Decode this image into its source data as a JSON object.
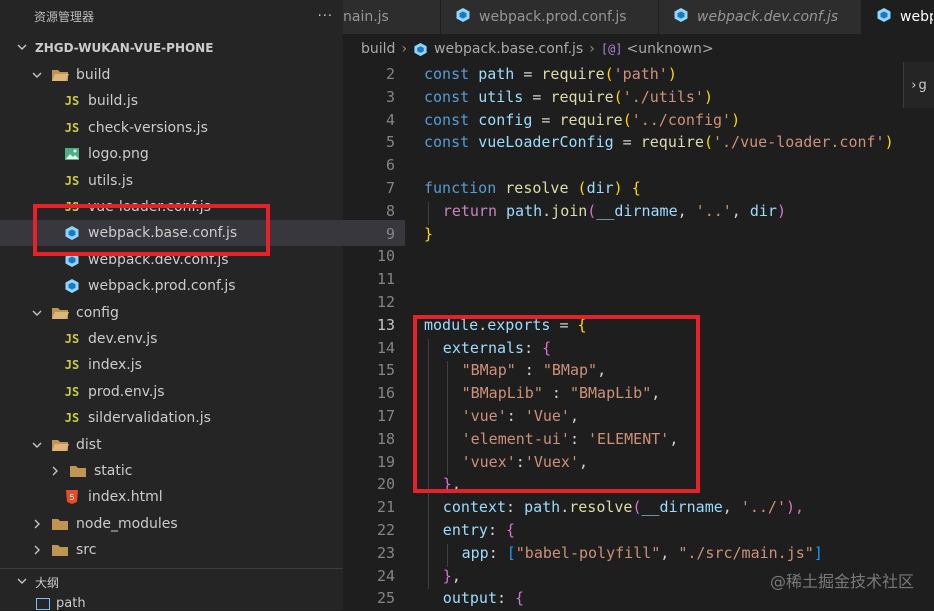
{
  "sidebar": {
    "title": "资源管理器",
    "more": "···",
    "project": "ZHGD-WUKAN-VUE-PHONE",
    "outline": "大纲",
    "outline_item": "path",
    "tree": [
      {
        "label": "build",
        "type": "folder",
        "open": true,
        "depth": 1,
        "icon": "folder-open-icon"
      },
      {
        "label": "build.js",
        "type": "js",
        "depth": 2,
        "icon": "js-file-icon"
      },
      {
        "label": "check-versions.js",
        "type": "js",
        "depth": 2,
        "icon": "js-file-icon"
      },
      {
        "label": "logo.png",
        "type": "image",
        "depth": 2,
        "icon": "image-file-icon"
      },
      {
        "label": "utils.js",
        "type": "js",
        "depth": 2,
        "icon": "js-file-icon"
      },
      {
        "label": "vue-loader.conf.js",
        "type": "js",
        "depth": 2,
        "icon": "js-file-icon"
      },
      {
        "label": "webpack.base.conf.js",
        "type": "webpack",
        "depth": 2,
        "icon": "webpack-icon",
        "selected": true
      },
      {
        "label": "webpack.dev.conf.js",
        "type": "webpack",
        "depth": 2,
        "icon": "webpack-icon"
      },
      {
        "label": "webpack.prod.conf.js",
        "type": "webpack",
        "depth": 2,
        "icon": "webpack-icon"
      },
      {
        "label": "config",
        "type": "folder",
        "open": true,
        "depth": 1,
        "icon": "folder-open-icon"
      },
      {
        "label": "dev.env.js",
        "type": "js",
        "depth": 2,
        "icon": "js-file-icon"
      },
      {
        "label": "index.js",
        "type": "js",
        "depth": 2,
        "icon": "js-file-icon"
      },
      {
        "label": "prod.env.js",
        "type": "js",
        "depth": 2,
        "icon": "js-file-icon"
      },
      {
        "label": "sildervalidation.js",
        "type": "js",
        "depth": 2,
        "icon": "js-file-icon"
      },
      {
        "label": "dist",
        "type": "folder",
        "open": true,
        "depth": 1,
        "icon": "folder-open-icon"
      },
      {
        "label": "static",
        "type": "folder",
        "open": false,
        "depth": 2,
        "icon": "folder-icon"
      },
      {
        "label": "index.html",
        "type": "html",
        "depth": 2,
        "icon": "html-file-icon"
      },
      {
        "label": "node_modules",
        "type": "folder",
        "open": false,
        "depth": 1,
        "icon": "folder-icon"
      },
      {
        "label": "src",
        "type": "folder",
        "open": false,
        "depth": 1,
        "icon": "folder-icon"
      }
    ]
  },
  "tabs": [
    {
      "label": "nain.js",
      "active": false,
      "icon": ""
    },
    {
      "label": "webpack.prod.conf.js",
      "active": false,
      "icon": "webpack-icon"
    },
    {
      "label": "webpack.dev.conf.js",
      "active": false,
      "icon": "webpack-icon",
      "italic": true
    },
    {
      "label": "webp",
      "active": true,
      "icon": "webpack-icon"
    }
  ],
  "breadcrumb": {
    "folder": "build",
    "file": "webpack.base.conf.js",
    "symbol_icon": "[@]",
    "symbol": "<unknown>"
  },
  "editor": {
    "current_line": 13,
    "lines": [
      {
        "n": "2"
      },
      {
        "n": "3"
      },
      {
        "n": "4"
      },
      {
        "n": "5"
      },
      {
        "n": "6"
      },
      {
        "n": "7"
      },
      {
        "n": "8"
      },
      {
        "n": "9"
      },
      {
        "n": "10"
      },
      {
        "n": "11"
      },
      {
        "n": "12"
      },
      {
        "n": "13"
      },
      {
        "n": "14"
      },
      {
        "n": "15"
      },
      {
        "n": "16"
      },
      {
        "n": "17"
      },
      {
        "n": "18"
      },
      {
        "n": "19"
      },
      {
        "n": "20"
      },
      {
        "n": "21"
      },
      {
        "n": "22"
      },
      {
        "n": "23"
      },
      {
        "n": "24"
      },
      {
        "n": "25"
      }
    ],
    "code": {
      "l2": [
        "const",
        " ",
        "path",
        " = ",
        "require",
        "(",
        "'path'",
        ")"
      ],
      "l3": [
        "const",
        " ",
        "utils",
        " = ",
        "require",
        "(",
        "'./utils'",
        ")"
      ],
      "l4": [
        "const",
        " ",
        "config",
        " = ",
        "require",
        "(",
        "'../config'",
        ")"
      ],
      "l5": [
        "const",
        " ",
        "vueLoaderConfig",
        " = ",
        "require",
        "(",
        "'./vue-loader.conf'",
        ")"
      ],
      "l7": [
        "function",
        " ",
        "resolve",
        " ",
        "(",
        "dir",
        ")",
        " ",
        "{"
      ],
      "l8": [
        "return",
        " ",
        "path",
        ".",
        "join",
        "(",
        "__dirname",
        ", ",
        "'..'",
        ", ",
        "dir",
        ")"
      ],
      "l9": [
        "}"
      ],
      "l13": [
        "module",
        ".",
        "exports",
        " = ",
        "{"
      ],
      "l14": [
        "externals",
        ": ",
        "{"
      ],
      "l15": [
        "\"BMap\"",
        " : ",
        "\"BMap\"",
        ","
      ],
      "l16": [
        "\"BMapLib\"",
        " : ",
        "\"BMapLib\"",
        ","
      ],
      "l17": [
        "'vue'",
        ": ",
        "'Vue'",
        ","
      ],
      "l18": [
        "'element-ui'",
        ": ",
        "'ELEMENT'",
        ","
      ],
      "l19": [
        "'vuex'",
        ":",
        "'Vuex'",
        ","
      ],
      "l20": [
        "}",
        ","
      ],
      "l21": [
        "context",
        ": ",
        "path",
        ".",
        "resolve",
        "(",
        "__dirname",
        ", ",
        "'../'",
        "),"
      ],
      "l22": [
        "entry",
        ": ",
        "{"
      ],
      "l23": [
        "app",
        ": ",
        "[",
        "\"babel-polyfill\"",
        ", ",
        "\"./src/main.js\"",
        "]"
      ],
      "l24": [
        "}",
        ","
      ],
      "l25": [
        "output",
        ": ",
        "{"
      ]
    }
  },
  "right_panel": {
    "label": "g"
  },
  "watermark": "@稀土掘金技术社区",
  "colors": {
    "highlight_box": "#e5222a",
    "selected_row": "#37373d",
    "editor_bg": "#1e1e1e",
    "sidebar_bg": "#252526"
  }
}
